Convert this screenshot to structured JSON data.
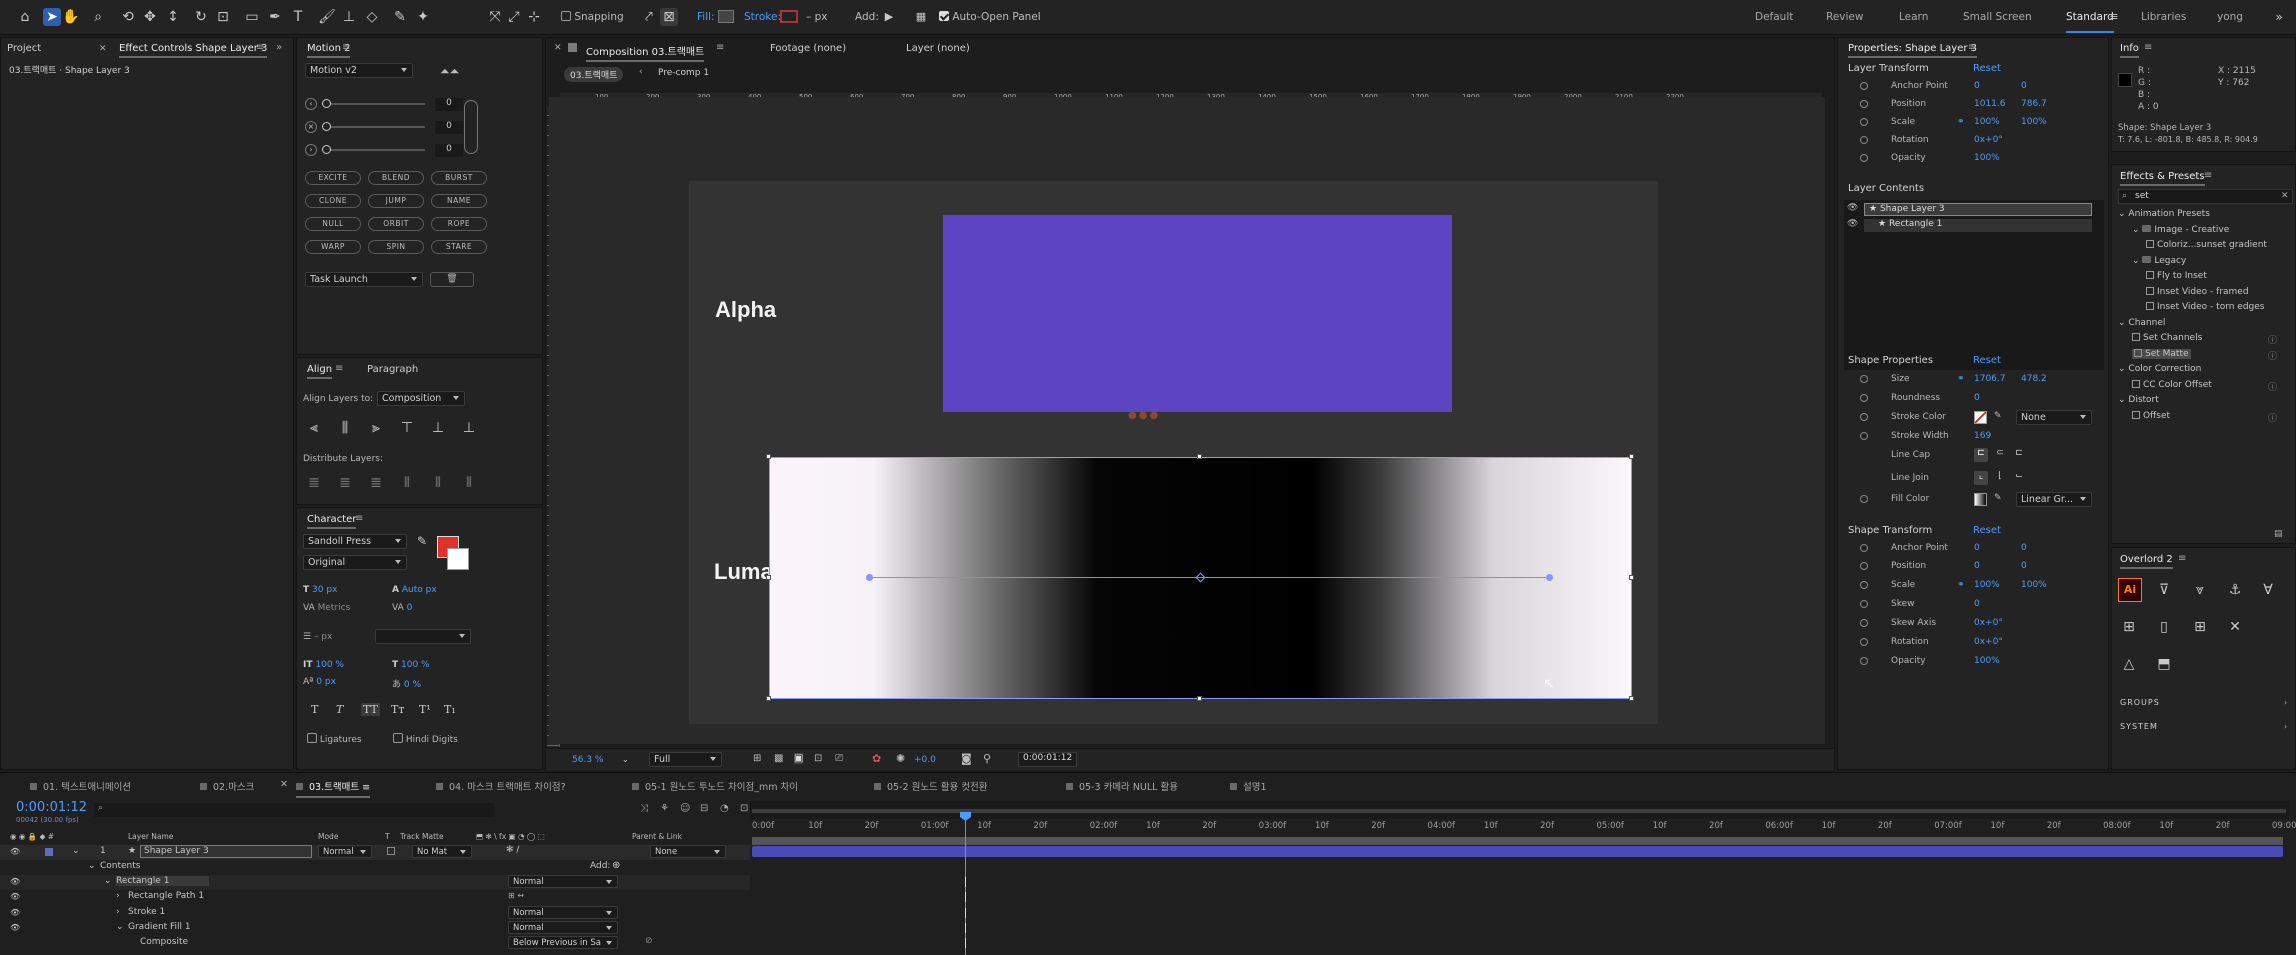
{
  "toolbar": {
    "snapping_label": "Snapping",
    "fill_label": "Fill:",
    "stroke_label": "Stroke:",
    "stroke_px": "– px",
    "add_label": "Add:",
    "auto_open_label": "Auto-Open Panel",
    "workspaces": [
      "Default",
      "Review",
      "Learn",
      "Small Screen",
      "Standard",
      "Libraries",
      "yong"
    ],
    "current_workspace": "Standard"
  },
  "left_panel": {
    "tab_project": "Project",
    "tab_effect_controls": "Effect Controls Shape Layer 3",
    "subtitle": "03.트랙매트 · Shape Layer 3"
  },
  "motion": {
    "title": "Motion 2",
    "version": "Motion v2",
    "slider_values": [
      "0",
      "0",
      "0"
    ],
    "chips": [
      "EXCITE",
      "BLEND",
      "BURST",
      "CLONE",
      "JUMP",
      "NAME",
      "NULL",
      "ORBIT",
      "ROPE",
      "WARP",
      "SPIN",
      "STARE"
    ],
    "task_launch": "Task Launch"
  },
  "align": {
    "tab_align": "Align",
    "tab_paragraph": "Paragraph",
    "align_to_label": "Align Layers to:",
    "align_to_value": "Composition",
    "distribute_label": "Distribute Layers:"
  },
  "character": {
    "title": "Character",
    "font": "Sandoll Press",
    "style": "Original",
    "size": "30 px",
    "leading": "Auto px",
    "kerning": "Metrics",
    "tracking": "0",
    "stroke_px": "– px",
    "vscale": "100 %",
    "hscale": "100 %",
    "baseline": "0 px",
    "tsume": "0 %",
    "ligatures": "Ligatures",
    "hindi": "Hindi Digits",
    "fill_color": "#e0312b"
  },
  "composition": {
    "tab_comp": "Composition 03.트랙매트",
    "tab_footage": "Footage (none)",
    "tab_layer": "Layer (none)",
    "crumb_1": "03.트랙매트",
    "crumb_2": "Pre-comp 1",
    "ruler_ticks": [
      "100",
      "200",
      "300",
      "400",
      "500",
      "600",
      "700",
      "800",
      "900",
      "1000",
      "1100",
      "1200",
      "1300",
      "1400",
      "1500",
      "1600",
      "1700",
      "1800",
      "1900",
      "2000",
      "2100",
      "2200"
    ],
    "label_alpha": "Alpha",
    "label_luma": "Luma",
    "zoom": "56.3 %",
    "quality": "Full",
    "exposure": "+0.0",
    "timecode": "0:00:01:12",
    "purple_color": "#5c45c2"
  },
  "properties": {
    "title": "Properties: Shape Layer 3",
    "layer_transform": "Layer Transform",
    "reset": "Reset",
    "anchor_label": "Anchor Point",
    "anchor": [
      "0",
      "0"
    ],
    "position_label": "Position",
    "position": [
      "1011.6",
      "786.7"
    ],
    "scale_label": "Scale",
    "scale": [
      "100%",
      "100%"
    ],
    "rotation_label": "Rotation",
    "rotation": "0x+0°",
    "opacity_label": "Opacity",
    "opacity": "100%",
    "layer_contents": "Layer Contents",
    "contents": [
      "Shape Layer 3",
      "Rectangle 1"
    ],
    "shape_props": "Shape Properties",
    "size_label": "Size",
    "size": [
      "1706.7",
      "478.2"
    ],
    "roundness_label": "Roundness",
    "roundness": "0",
    "stroke_color_label": "Stroke Color",
    "stroke_type": "None",
    "stroke_width_label": "Stroke Width",
    "stroke_width": "169",
    "line_cap_label": "Line Cap",
    "line_join_label": "Line Join",
    "fill_color_label": "Fill Color",
    "fill_type": "Linear Gr...",
    "shape_transform": "Shape Transform",
    "st_anchor": [
      "0",
      "0"
    ],
    "st_position": [
      "0",
      "0"
    ],
    "st_scale": [
      "100%",
      "100%"
    ],
    "skew_label": "Skew",
    "skew": "0",
    "skew_axis_label": "Skew Axis",
    "skew_axis": "0x+0°",
    "st_rotation": "0x+0°",
    "st_opacity": "100%"
  },
  "info": {
    "title": "Info",
    "r": "R :",
    "g": "G :",
    "b": "B :",
    "a": "A : 0",
    "x": "X : 2115",
    "y": "Y : 762",
    "shape": "Shape: Shape Layer 3",
    "coords": "T: 7.6, L: -801.8, B: 485.8, R: 904.9"
  },
  "effects": {
    "title": "Effects & Presets",
    "search": "set",
    "items": [
      {
        "t": "Animation Presets",
        "lvl": 0,
        "k": "cat"
      },
      {
        "t": "Image - Creative",
        "lvl": 1,
        "k": "folder"
      },
      {
        "t": "Coloriz...sunset gradient",
        "lvl": 2,
        "k": "fx"
      },
      {
        "t": "Legacy",
        "lvl": 1,
        "k": "folder"
      },
      {
        "t": "Fly to Inset",
        "lvl": 2,
        "k": "fx"
      },
      {
        "t": "Inset Video - framed",
        "lvl": 2,
        "k": "fx"
      },
      {
        "t": "Inset Video - torn edges",
        "lvl": 2,
        "k": "fx"
      },
      {
        "t": "Channel",
        "lvl": 0,
        "k": "cat"
      },
      {
        "t": "Set Channels",
        "lvl": 1,
        "k": "fx"
      },
      {
        "t": "Set Matte",
        "lvl": 1,
        "k": "fx",
        "sel": true
      },
      {
        "t": "Color Correction",
        "lvl": 0,
        "k": "cat"
      },
      {
        "t": "CC Color Offset",
        "lvl": 1,
        "k": "fx"
      },
      {
        "t": "Distort",
        "lvl": 0,
        "k": "cat"
      },
      {
        "t": "Offset",
        "lvl": 1,
        "k": "fx"
      }
    ]
  },
  "overlord": {
    "title": "Overlord 2",
    "groups": "GROUPS",
    "system": "SYSTEM"
  },
  "timeline": {
    "tabs": [
      "01. 텍스트애니메이션",
      "02.마스크",
      "03.트랙매트",
      "04. 마스크 트랙매트 차이점?",
      "05-1 원노드 투노드 차이점_mm 차이",
      "05-2 원노드 활용 컷전환",
      "05-3 카메라 NULL 활용",
      "설명1"
    ],
    "active_tab": 2,
    "timecode": "0:00:01:12",
    "frames": "00042 (30.00 fps)",
    "col_layer_name": "Layer Name",
    "col_mode": "Mode",
    "col_t": "T",
    "col_trackmatte": "Track Matte",
    "col_parent": "Parent & Link",
    "layer_num": "1",
    "layer_name": "Shape Layer 3",
    "layer_mode": "Normal",
    "layer_matte": "No Mat",
    "layer_parent": "None",
    "contents": "Contents",
    "add": "Add:",
    "rows": [
      {
        "name": "Rectangle 1",
        "mode": "Normal",
        "indent": 1
      },
      {
        "name": "Rectangle Path 1",
        "mode": "",
        "indent": 2
      },
      {
        "name": "Stroke 1",
        "mode": "Normal",
        "indent": 2
      },
      {
        "name": "Gradient Fill 1",
        "mode": "Normal",
        "indent": 2
      },
      {
        "name": "Composite",
        "mode": "Below Previous in Sa",
        "indent": 3
      }
    ],
    "ticks": [
      "0:00f",
      "10f",
      "20f",
      "01:00f",
      "10f",
      "20f",
      "02:00f",
      "10f",
      "20f",
      "03:00f",
      "10f",
      "20f",
      "04:00f",
      "10f",
      "20f",
      "05:00f",
      "10f",
      "20f",
      "06:00f",
      "10f",
      "20f",
      "07:00f",
      "10f",
      "20f",
      "08:00f",
      "10f",
      "20f",
      "09:00"
    ]
  }
}
